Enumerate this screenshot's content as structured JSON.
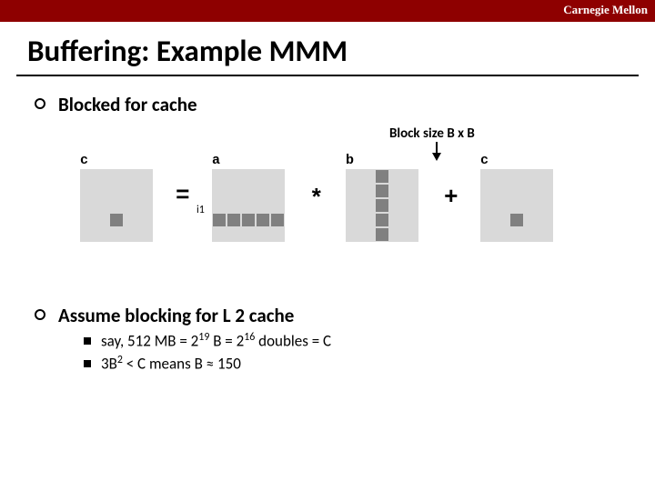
{
  "brand": "Carnegie Mellon",
  "title": "Buffering: Example MMM",
  "bullet1": "Blocked for cache",
  "annotation": "Block size B x B",
  "labels": {
    "c1": "c",
    "a": "a",
    "b": "b",
    "c2": "c"
  },
  "ops": {
    "eq": "=",
    "mul": "*",
    "plus": "+"
  },
  "i1": "i1",
  "bullet2": "Assume blocking for L 2 cache",
  "sub1_pre": "say, 512 MB = 2",
  "sub1_exp1": "19",
  "sub1_mid": " B = 2",
  "sub1_exp2": "16",
  "sub1_post": " doubles = C",
  "sub2_pre": "3B",
  "sub2_exp": "2",
  "sub2_post": " < C means B ≈ 150"
}
